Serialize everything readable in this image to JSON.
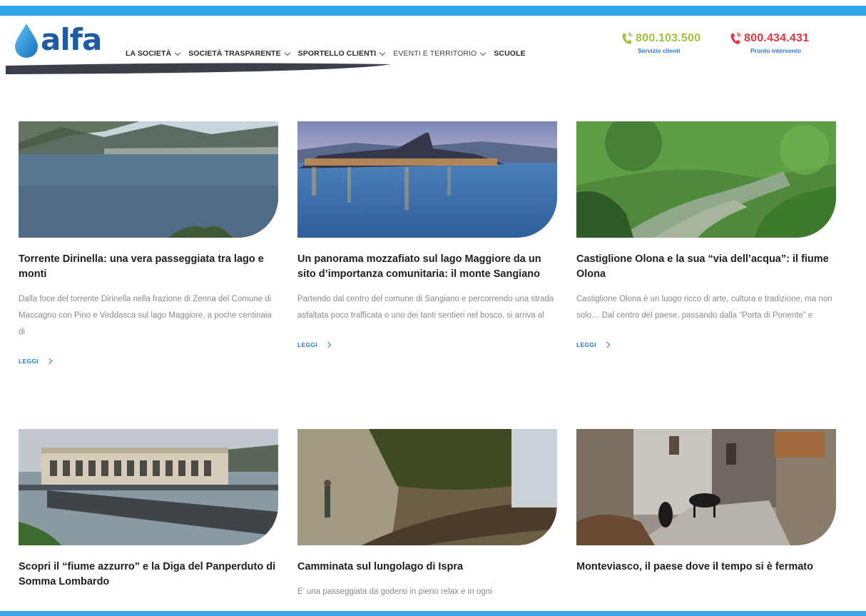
{
  "brand": {
    "logo_text": "alfa"
  },
  "nav": {
    "items": [
      {
        "label": "LA SOCIETÀ",
        "dropdown": true
      },
      {
        "label": "SOCIETÀ TRASPARENTE",
        "dropdown": true
      },
      {
        "label": "SPORTELLO CLIENTI",
        "dropdown": true
      },
      {
        "label": "EVENTI E TERRITORIO",
        "dropdown": true
      },
      {
        "label": "SCUOLE",
        "dropdown": false
      }
    ]
  },
  "contacts": [
    {
      "number": "800.103.500",
      "label": "Servizio clienti",
      "color": "#9cc43a"
    },
    {
      "number": "800.434.431",
      "label": "Pronto intervento",
      "color": "#e0363f"
    }
  ],
  "cards": [
    {
      "title": "Torrente Dirinella: una vera passeggiata tra lago e monti",
      "excerpt": "Dalla foce del torrente Dirinella nella frazione di Zenna del Comune di Maccagno con Pino e Veddasca sul lago Maggiore, a poche centinaia di",
      "more": "LEGGI",
      "image": "lake-mountains-photo"
    },
    {
      "title": "Un panorama mozzafiato sul lago Maggiore da un sito d’importanza comunitaria: il monte Sangiano",
      "excerpt": "Partendo dal centro del comune di Sangiano e percorrendo una strada asfaltata poco trafficata o uno dei tanti sentieri nel bosco,  si arriva al",
      "more": "LEGGI",
      "image": "island-dusk-photo"
    },
    {
      "title": "Castiglione Olona e la sua “via dell’acqua”: il fiume Olona",
      "excerpt": "Castiglione Olona è un luogo ricco di arte, cultura e tradizione, ma non solo… Dal centro del paese, passando dalla “Porta di Ponente” e",
      "more": "LEGGI",
      "image": "river-forest-photo"
    },
    {
      "title": "Scopri il “fiume azzurro” e la Diga del Panperduto di Somma Lombardo",
      "excerpt": "",
      "more": "",
      "image": "dam-photo"
    },
    {
      "title": "Camminata sul lungolago di Ispra",
      "excerpt": "E’ una passeggiata da godersi in pieno relax e in ogni",
      "more": "",
      "image": "lakeside-path-photo"
    },
    {
      "title": "Monteviasco, il paese dove il tempo si è fermato",
      "excerpt": "",
      "more": "",
      "image": "village-goats-photo"
    }
  ],
  "colors": {
    "accent_blue": "#2ea3e6",
    "brand_blue": "#1d5aa8",
    "link_blue": "#2a7cc8"
  }
}
